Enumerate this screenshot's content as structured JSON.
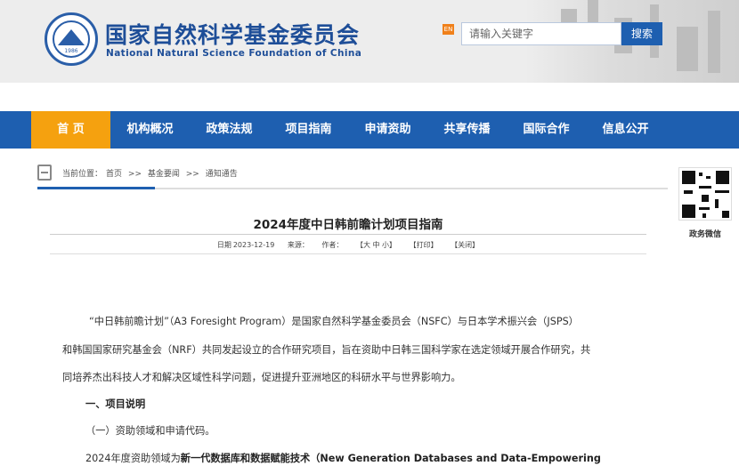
{
  "header": {
    "title_cn": "国家自然科学基金委员会",
    "title_en": "National Natural Science Foundation of China",
    "logo_year": "1986",
    "en_badge": "EN",
    "search_placeholder": "请输入关键字",
    "search_button": "搜索"
  },
  "nav": {
    "items": [
      "首 页",
      "机构概况",
      "政策法规",
      "项目指南",
      "申请资助",
      "共享传播",
      "国际合作",
      "信息公开"
    ],
    "active_index": 0
  },
  "breadcrumb": {
    "prefix": "当前位置：",
    "items": [
      "首页",
      "基金要闻",
      "通知通告"
    ],
    "separator": ">>"
  },
  "sidebar": {
    "qr_label": "政务微信"
  },
  "article": {
    "title": "2024年度中日韩前瞻计划项目指南",
    "meta": {
      "date_label": "日期",
      "date": "2023-12-19",
      "source_label": "来源：",
      "author_label": "作者：",
      "font_size": "【大 中 小】",
      "print": "【打印】",
      "close": "【关闭】"
    },
    "p1_line1": "“中日韩前瞻计划”（A3 Foresight Program）是国家自然科学基金委员会（NSFC）与日本学术振兴会（JSPS）",
    "p1_line2": "和韩国国家研究基金会（NRF）共同发起设立的合作研究项目，旨在资助中日韩三国科学家在选定领域开展合作研究，共",
    "p1_line3": "同培养杰出科技人才和解决区域性科学问题，促进提升亚洲地区的科研水平与世界影响力。",
    "section1": "一、项目说明",
    "sub1": "（一）资助领域和申请代码。",
    "p2_prefix": "2024年度资助领域为",
    "p2_bold": "新一代数据库和数据赋能技术（New Generation Databases and Data-Empowering"
  },
  "colors": {
    "brand_blue": "#1e5fb0",
    "nav_active": "#f5a10f",
    "en_badge": "#f0801a"
  }
}
